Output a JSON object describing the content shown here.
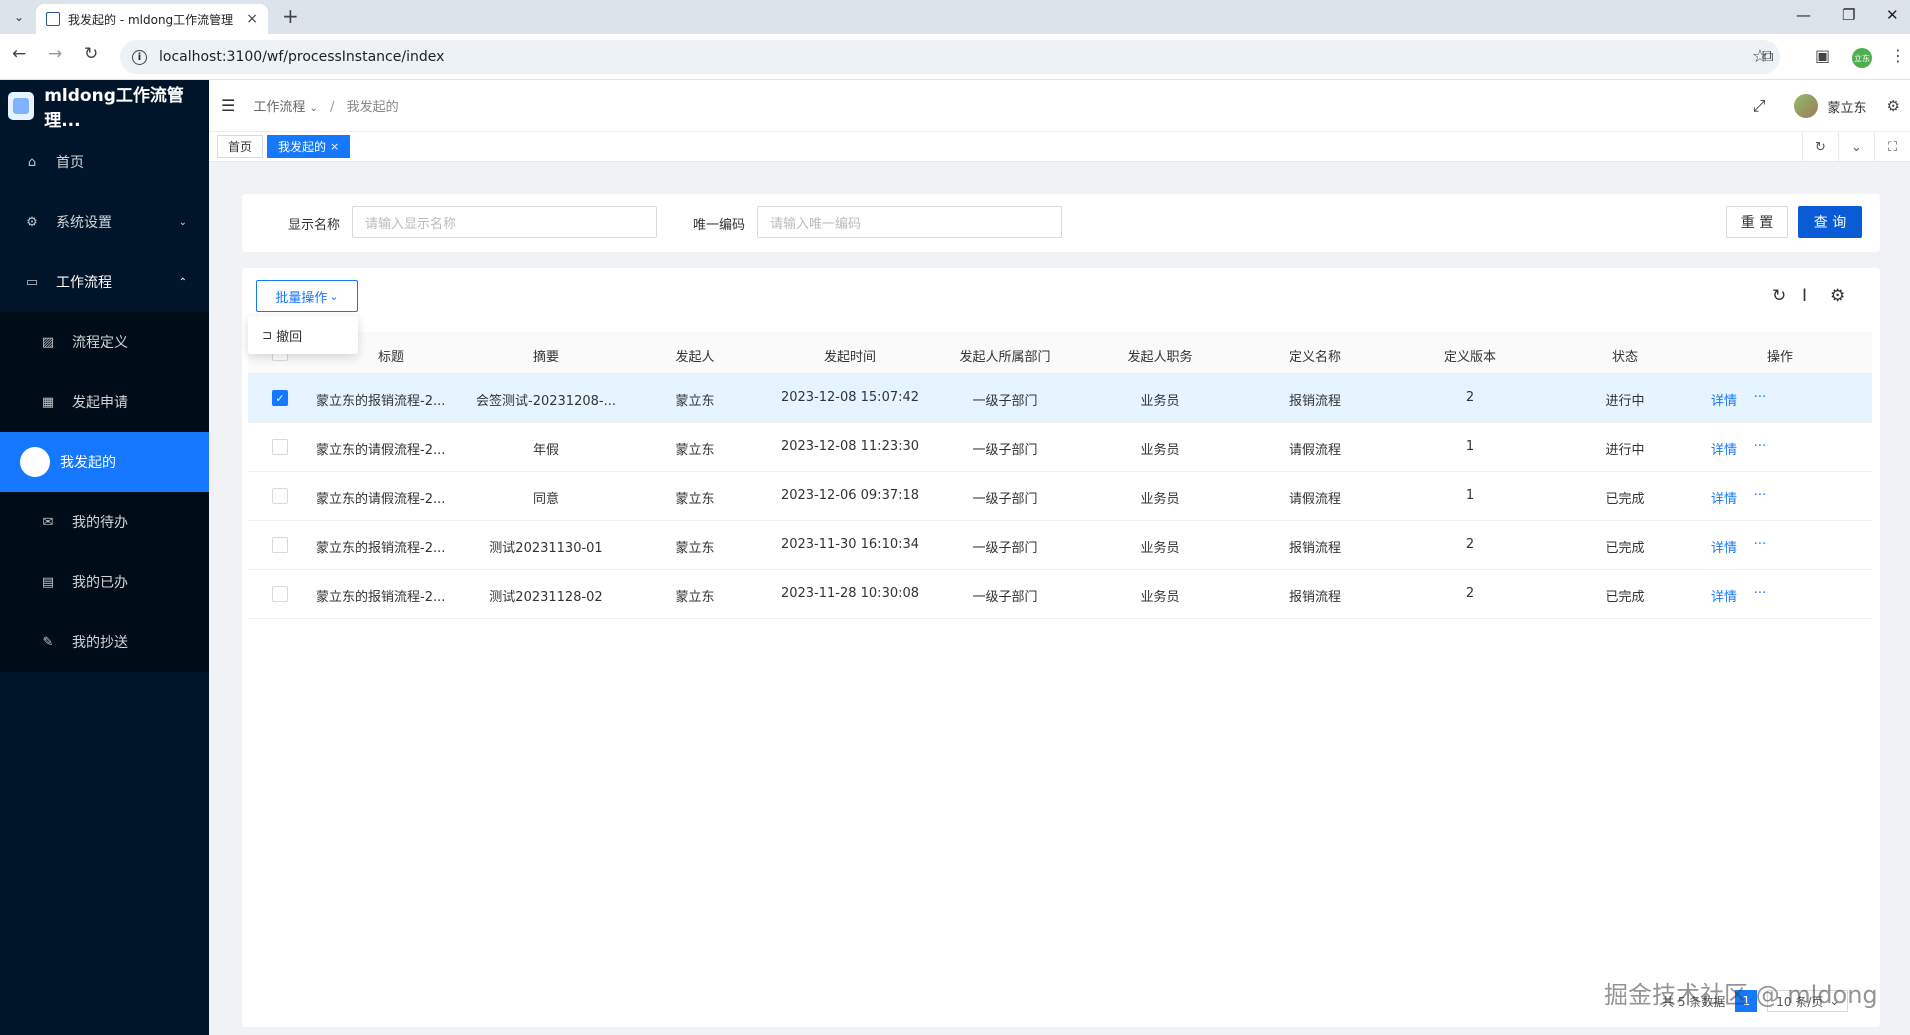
{
  "browser": {
    "tab_title": "我发起的 - mldong工作流管理",
    "url": "localhost:3100/wf/processInstance/index",
    "profile_badge": "立东"
  },
  "app": {
    "name": "mldong工作流管理..."
  },
  "sidebar": {
    "items": [
      {
        "label": "首页",
        "icon": "home-icon"
      },
      {
        "label": "系统设置",
        "icon": "settings-icon"
      },
      {
        "label": "工作流程",
        "icon": "workflow-icon"
      }
    ],
    "sub_items": [
      {
        "label": "流程定义",
        "icon": "image-icon"
      },
      {
        "label": "发起申请",
        "icon": "grid-icon"
      },
      {
        "label": "我发起的",
        "icon": "dot-icon",
        "active": true
      },
      {
        "label": "我的待办",
        "icon": "mail-icon"
      },
      {
        "label": "我的已办",
        "icon": "book-icon"
      },
      {
        "label": "我的抄送",
        "icon": "edit-icon"
      }
    ]
  },
  "header": {
    "breadcrumb": [
      "工作流程",
      "我发起的"
    ],
    "username": "蒙立东"
  },
  "tags": [
    {
      "label": "首页"
    },
    {
      "label": "我发起的",
      "close": "×"
    }
  ],
  "search": {
    "name_label": "显示名称",
    "name_placeholder": "请输入显示名称",
    "code_label": "唯一编码",
    "code_placeholder": "请输入唯一编码",
    "reset_label": "重 置",
    "query_label": "查 询"
  },
  "table": {
    "batch_label": "批量操作",
    "dropdown_item": "撤回",
    "columns": [
      "标题",
      "摘要",
      "发起人",
      "发起时间",
      "发起人所属部门",
      "发起人职务",
      "定义名称",
      "定义版本",
      "状态",
      "操作"
    ],
    "rows": [
      {
        "title": "蒙立东的报销流程-2...",
        "summary": "会签测试-20231208-...",
        "initiator": "蒙立东",
        "time": "2023-12-08 15:07:42",
        "dept": "一级子部门",
        "position": "业务员",
        "def_name": "报销流程",
        "version": "2",
        "status": "进行中",
        "detail": "详情",
        "more": "···",
        "checked": true
      },
      {
        "title": "蒙立东的请假流程-2...",
        "summary": "年假",
        "initiator": "蒙立东",
        "time": "2023-12-08 11:23:30",
        "dept": "一级子部门",
        "position": "业务员",
        "def_name": "请假流程",
        "version": "1",
        "status": "进行中",
        "detail": "详情",
        "more": "···",
        "checked": false
      },
      {
        "title": "蒙立东的请假流程-2...",
        "summary": "同意",
        "initiator": "蒙立东",
        "time": "2023-12-06 09:37:18",
        "dept": "一级子部门",
        "position": "业务员",
        "def_name": "请假流程",
        "version": "1",
        "status": "已完成",
        "detail": "详情",
        "more": "···",
        "checked": false
      },
      {
        "title": "蒙立东的报销流程-2...",
        "summary": "测试20231130-01",
        "initiator": "蒙立东",
        "time": "2023-11-30 16:10:34",
        "dept": "一级子部门",
        "position": "业务员",
        "def_name": "报销流程",
        "version": "2",
        "status": "已完成",
        "detail": "详情",
        "more": "···",
        "checked": false
      },
      {
        "title": "蒙立东的报销流程-2...",
        "summary": "测试20231128-02",
        "initiator": "蒙立东",
        "time": "2023-11-28 10:30:08",
        "dept": "一级子部门",
        "position": "业务员",
        "def_name": "报销流程",
        "version": "2",
        "status": "已完成",
        "detail": "详情",
        "more": "···",
        "checked": false
      }
    ]
  },
  "pagination": {
    "total_text": "共 5 条数据",
    "current_page": "1",
    "page_size": "10 条/页"
  },
  "watermark": "掘金技术社区 @ mldong",
  "colors": {
    "sidebar_bg": "#001529",
    "primary": "#1677ff",
    "query_btn": "#0a5bd6"
  }
}
